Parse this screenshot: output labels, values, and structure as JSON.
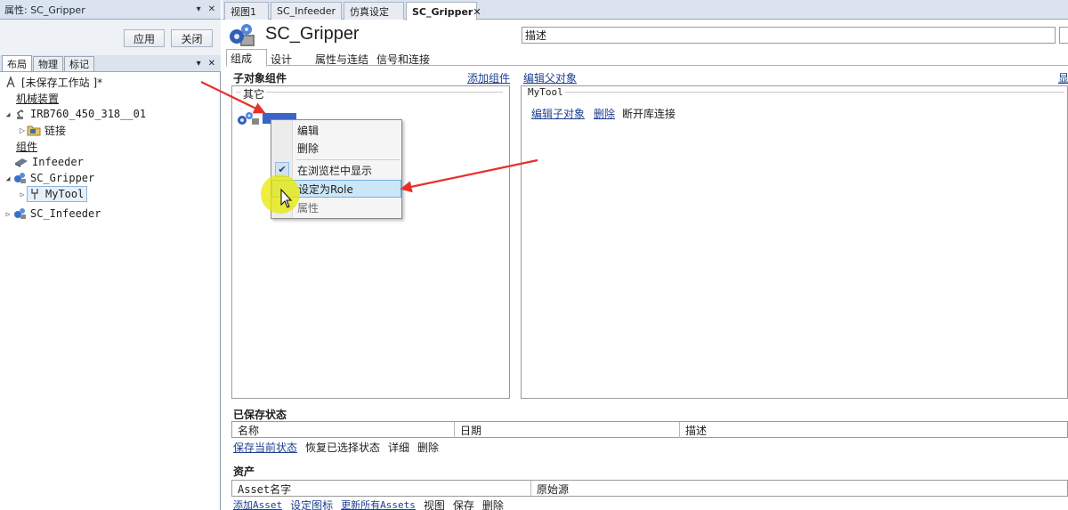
{
  "properties_panel": {
    "title": "属性: SC_Gripper",
    "apply_label": "应用",
    "close_label": "关闭"
  },
  "layout_panel": {
    "tabs": [
      "布局",
      "物理",
      "标记"
    ],
    "tree": {
      "station": "[未保存工作站 ]*",
      "mechanisms_header": "机械装置",
      "robot": "IRB760_450_318__01",
      "links": "链接",
      "components_header": "组件",
      "infeeder": "Infeeder",
      "gripper": "SC_Gripper",
      "mytool": "MyTool",
      "sc_infeeder": "SC_Infeeder"
    }
  },
  "doc_tabs": [
    "视图1",
    "SC_Infeeder",
    "仿真设定",
    "SC_Gripper"
  ],
  "editor": {
    "component_name": "SC_Gripper",
    "description_label": "描述",
    "description_value": "",
    "tabs": [
      "组成",
      "设计",
      "属性与连结",
      "信号和连接"
    ],
    "child_components_label": "子对象组件",
    "add_component_link": "添加组件",
    "edit_parent_link": "编辑父对象",
    "other_group": "其它",
    "mytool_group": "MyTool",
    "edit_child_link": "编辑子对象",
    "delete_link": "删除",
    "disconnect_library": "断开库连接",
    "right_edge_glyph": "显"
  },
  "saved_states": {
    "title": "已保存状态",
    "columns": [
      "名称",
      "日期",
      "描述"
    ],
    "actions": [
      "保存当前状态",
      "恢复已选择状态",
      "详细",
      "删除"
    ]
  },
  "assets": {
    "title": "资产",
    "columns": [
      "Asset名字",
      "原始源"
    ],
    "actions": [
      "添加Asset",
      "设定图标",
      "更新所有Assets",
      "视图",
      "保存",
      "删除"
    ]
  },
  "context_menu": {
    "items": [
      "编辑",
      "删除",
      "在浏览栏中显示",
      "设定为Role",
      "属性"
    ],
    "checked_item": "在浏览栏中显示",
    "highlighted_item": "设定为Role"
  },
  "colors": {
    "accent_highlight": "#cde6f7",
    "arrow_red": "#e8302a",
    "cursor_halo": "#e8e800"
  }
}
